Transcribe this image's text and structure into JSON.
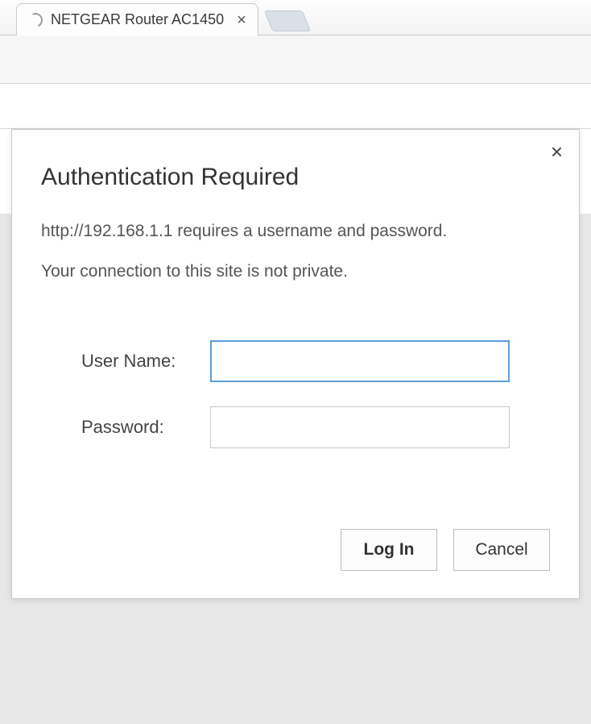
{
  "browser": {
    "tab_title": "NETGEAR Router AC1450"
  },
  "dialog": {
    "title": "Authentication Required",
    "message_line1": "http://192.168.1.1 requires a username and password.",
    "message_line2": "Your connection to this site is not private.",
    "username_label": "User Name:",
    "password_label": "Password:",
    "username_value": "",
    "password_value": "",
    "login_label": "Log In",
    "cancel_label": "Cancel"
  }
}
